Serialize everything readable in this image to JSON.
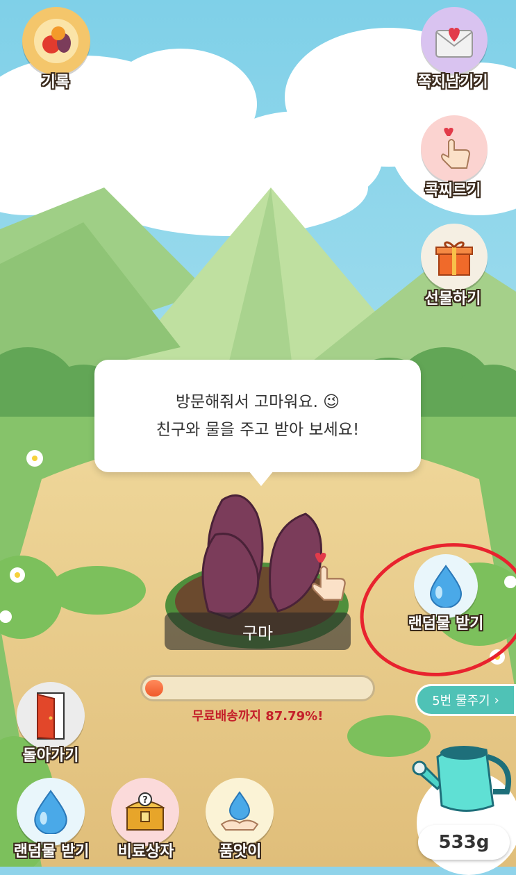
{
  "top_left": {
    "label": "기록",
    "icon": "fruit-basket-icon"
  },
  "right_menu": [
    {
      "label": "쪽지남기기",
      "icon": "love-letter-icon"
    },
    {
      "label": "콕찌르기",
      "icon": "poke-finger-icon"
    },
    {
      "label": "선물하기",
      "icon": "gift-box-icon"
    }
  ],
  "speech_bubble": {
    "line1": "방문해줘서 고마워요. 😉",
    "line2": "친구와 물을 주고 받아 보세요!"
  },
  "plant": {
    "name": "구마"
  },
  "random_water": {
    "label": "랜덤물 받기",
    "icon": "water-drop-icon"
  },
  "progress": {
    "text": "무료배송까지 87.79%!",
    "fraction": 0.08
  },
  "water_five": {
    "label": "5번 물주기",
    "chevron": "›"
  },
  "watering_can": {
    "weight": "533g",
    "icon": "watering-can-icon"
  },
  "back": {
    "label": "돌아가기",
    "icon": "door-icon"
  },
  "bottom_menu": [
    {
      "label": "랜덤물 받기",
      "icon": "water-drop-icon"
    },
    {
      "label": "비료상자",
      "icon": "treasure-chest-icon"
    },
    {
      "label": "품앗이",
      "icon": "hand-drop-icon"
    }
  ],
  "colors": {
    "accent": "#4fc2b6",
    "progress_fill": "#f05a2a",
    "progress_text": "#c4202a",
    "highlight_ring": "#e8232e"
  }
}
